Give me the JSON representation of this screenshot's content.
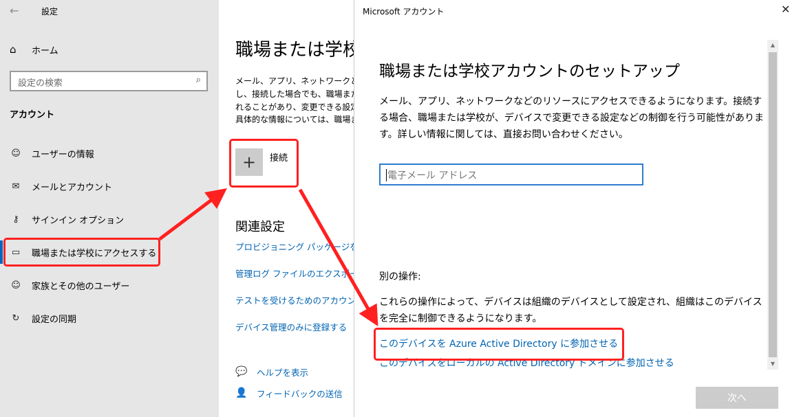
{
  "settings": {
    "app_title": "設定",
    "back_icon": "←",
    "home": {
      "icon": "⌂",
      "label": "ホーム"
    },
    "search": {
      "placeholder": "設定の検索",
      "icon": "⌕"
    },
    "section": "アカウント",
    "nav": [
      {
        "icon": "☺",
        "label": "ユーザーの情報"
      },
      {
        "icon": "✉",
        "label": "メールとアカウント"
      },
      {
        "icon": "⚷",
        "label": "サインイン オプション"
      },
      {
        "icon": "▭",
        "label": "職場または学校にアクセスする"
      },
      {
        "icon": "☺",
        "label": "家族とその他のユーザー"
      },
      {
        "icon": "↻",
        "label": "設定の同期"
      }
    ]
  },
  "content": {
    "title": "職場または学校にアクセスする",
    "description": [
      "メール、アプリ、ネットワークといったリソースへのアクセス権を取得します。接続すると、接続した場合でも、職場または学校によってデバイスで変更",
      "し、接続した場合でも、職場または学校がこのデバイスで変更できる設定など、一部制限が行われ",
      "れることがあり、変更できる設定などは異なります。",
      "具体的な情報については、職場または学校にお問い合わせください。"
    ],
    "connect": {
      "icon": "+",
      "label": "接続"
    },
    "related_title": "関連設定",
    "links": [
      "プロビジョニング パッケージを追加または削除する",
      "管理ログ ファイルのエクスポート",
      "テストを受けるためのアカウントの設定",
      "デバイス管理のみに登録する"
    ],
    "help": {
      "icon": "💬",
      "label": "ヘルプを表示"
    },
    "feedback": {
      "icon": "👤",
      "label": "フィードバックの送信"
    }
  },
  "dialog": {
    "title": "Microsoft アカウント",
    "close_icon": "✕",
    "heading": "職場または学校アカウントのセットアップ",
    "body": "メール、アプリ、ネットワークなどのリソースにアクセスできるようになります。接続する場合、職場または学校が、デバイスで変更できる設定などの制御を行う可能性があります。詳しい情報に関しては、直接お問い合わせください。",
    "email_placeholder": "電子メール アドレス",
    "alt_title": "別の操作:",
    "alt_desc": "これらの操作によって、デバイスは組織のデバイスとして設定され、組織はこのデバイスを完全に制御できるようになります。",
    "azure_link": "このデバイスを Azure Active Directory に参加させる",
    "local_link": "このデバイスをローカルの Active Directory ドメインに参加させる",
    "next_button": "次へ",
    "scroll_up_icon": "▲",
    "scroll_down_icon": "▼"
  },
  "colors": {
    "accent": "#0067c0",
    "link": "#0063b1",
    "callout": "#ff2020",
    "sidebar_bg": "#e6e6e6"
  }
}
